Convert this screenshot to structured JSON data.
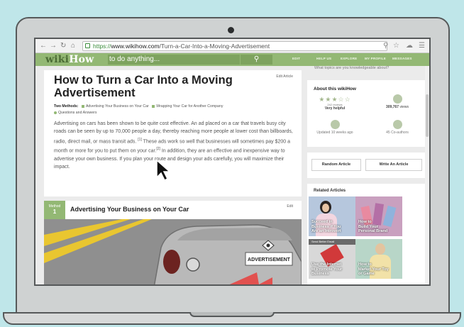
{
  "browser": {
    "url_scheme": "https://",
    "url_host": "www.wikihow.com",
    "url_path": "/Turn-a-Car-Into-a-Moving-Advertisement"
  },
  "header": {
    "logo_wiki": "wiki",
    "logo_how": "How",
    "search_placeholder": "to do anything...",
    "nav": [
      "EDIT",
      "HELP US",
      "EXPLORE",
      "MY PROFILE",
      "MESSAGES"
    ]
  },
  "article": {
    "title": "How to Turn a Car Into a Moving Advertisement",
    "edit_label": "Edit Article",
    "methods_label": "Two Methods:",
    "methods": [
      "Advertising Your Business on Your Car",
      "Wrapping Your Car for Another Company"
    ],
    "qa_label": "Questions and Answers",
    "intro_p1": "Advertising on cars has been shown to be quite cost effective. An ad placed on a car that travels busy city roads can be seen by up to 70,000 people a day, thereby reaching more people at lower cost than billboards, radio, direct mail, or mass transit ads.",
    "ref1": "[1]",
    "intro_p2": " These ads work so well that businesses will sometimes pay $200 a month or more for you to put them on your car.",
    "ref2": "[2]",
    "intro_p3": " In addition, they are an effective and inexpensive way to advertise your own business. If you plan your route and design your ads carefully, you will maximize their impact."
  },
  "method": {
    "badge_label": "Method",
    "badge_num": "1",
    "title": "Advertising Your Business on Your Car",
    "edit": "Edit",
    "car_sign": "ADVERTISEMENT"
  },
  "sidebar": {
    "question": "What topics are you knowledgeable about?",
    "about_title": "About this wikiHow",
    "reviews": "242 reviews",
    "rating_text": "Very helpful",
    "views": "309,767",
    "views_label": "views",
    "updated": "Updated 10 weeks ago",
    "coauthors": "45 Co-authors",
    "random_article": "Random Article",
    "write_article": "Write An Article",
    "related_title": "Related Articles",
    "related": [
      {
        "label1": "Succeed in",
        "label2": "Business if You",
        "label3": "Are an Introvert"
      },
      {
        "label1": "How to",
        "label2": "Build Your",
        "label3": "Personal Brand"
      },
      {
        "label1": "Use the Internet",
        "label2": "to Promote Your",
        "label3": "Business"
      },
      {
        "label1": "How to",
        "label2": "Market Your Toy",
        "label3": "or Game"
      }
    ],
    "related_overlay": "Send Better Email"
  },
  "colors": {
    "wikihow_green": "#93b874",
    "background": "#bfe6e9"
  }
}
